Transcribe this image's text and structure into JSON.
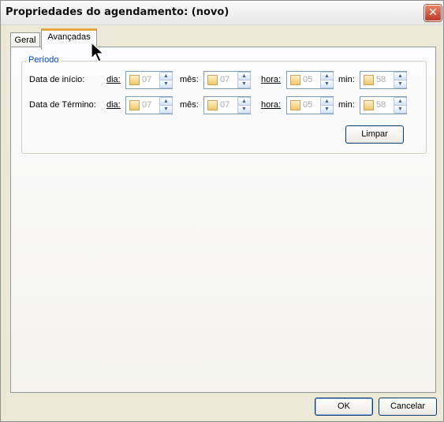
{
  "window": {
    "title": "Propriedades do agendamento: (novo)",
    "close_glyph": "✕"
  },
  "tabs": [
    {
      "label": "Geral",
      "active": false
    },
    {
      "label": "Avançadas",
      "active": true
    }
  ],
  "periodo": {
    "label": "Período",
    "rows": [
      {
        "label": "Data de início:",
        "fields": [
          {
            "label": "dia:",
            "value": "07"
          },
          {
            "label": "mês:",
            "value": "07"
          },
          {
            "label": "hora:",
            "value": "05"
          },
          {
            "label": "min:",
            "value": "58"
          }
        ]
      },
      {
        "label": "Data de Término:",
        "fields": [
          {
            "label": "dia:",
            "value": "07"
          },
          {
            "label": "mês:",
            "value": "07"
          },
          {
            "label": "hora:",
            "value": "05"
          },
          {
            "label": "min:",
            "value": "58"
          }
        ]
      }
    ],
    "clear_label": "Limpar"
  },
  "footer": {
    "ok_label": "OK",
    "cancel_label": "Cancelar"
  },
  "spinner": {
    "up_glyph": "▲",
    "down_glyph": "▼"
  }
}
